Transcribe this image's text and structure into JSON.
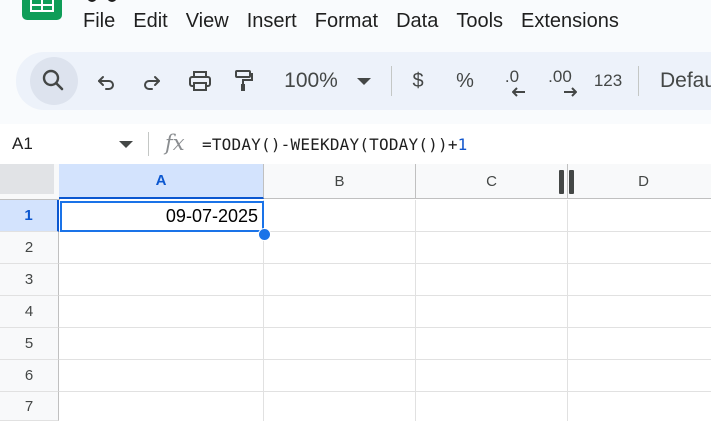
{
  "menu": {
    "items": [
      "File",
      "Edit",
      "View",
      "Insert",
      "Format",
      "Data",
      "Tools",
      "Extensions"
    ]
  },
  "toolbar": {
    "zoom": "100%",
    "currency": "$",
    "percent": "%",
    "decrease_decimal": ".0",
    "increase_decimal": ".00",
    "number_format": "123",
    "font_default": "Defau"
  },
  "formula_bar": {
    "name_box": "A1",
    "fx": "fx",
    "formula_text": "=TODAY()-WEEKDAY(TODAY())+",
    "formula_number": "1"
  },
  "grid": {
    "columns": [
      "A",
      "B",
      "C",
      "D"
    ],
    "rows": [
      "1",
      "2",
      "3",
      "4",
      "5",
      "6",
      "7"
    ],
    "selected_cell": "A1",
    "cells": {
      "A1": "09-07-2025"
    }
  },
  "colors": {
    "selection_blue": "#1a73e8",
    "header_selected_bg": "#d3e3fd",
    "sheets_green": "#0f9d58"
  }
}
